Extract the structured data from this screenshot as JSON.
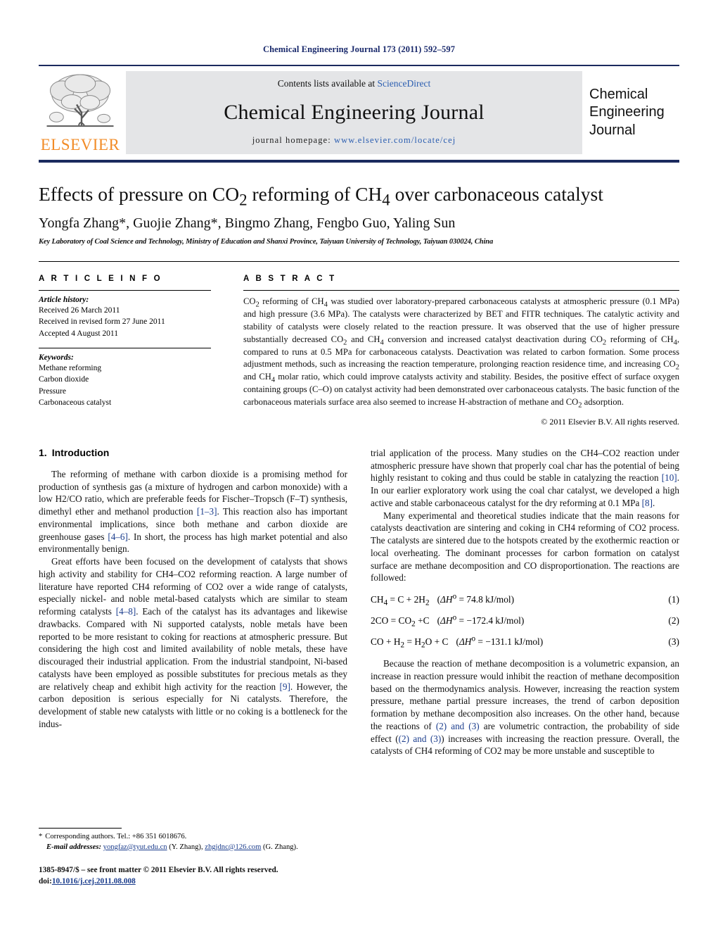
{
  "running_head": "Chemical Engineering Journal 173 (2011) 592–597",
  "masthead": {
    "publisher_logo_text": "ELSEVIER",
    "contents_prefix": "Contents lists available at",
    "contents_link": "ScienceDirect",
    "journal_title": "Chemical Engineering Journal",
    "homepage_prefix": "journal homepage:",
    "homepage_url": "www.elsevier.com/locate/cej",
    "cover_line_1": "Chemical",
    "cover_line_2": "Engineering",
    "cover_line_3": "Journal",
    "accent_color": "#F28C28",
    "link_color": "#2a5db0",
    "rule_color": "#1b2a5e"
  },
  "article": {
    "title_part_1": "Effects of pressure on CO",
    "title_sub_1": "2",
    "title_part_2": " reforming of CH",
    "title_sub_2": "4",
    "title_part_3": " over carbonaceous catalyst",
    "authors": "Yongfa Zhang*, Guojie Zhang*, Bingmo Zhang, Fengbo Guo, Yaling Sun",
    "affiliation": "Key Laboratory of Coal Science and Technology, Ministry of Education and Shanxi Province, Taiyuan University of Technology, Taiyuan 030024, China"
  },
  "article_info": {
    "heading": "A R T I C L E   I N F O",
    "history_label": "Article history:",
    "history": [
      "Received 26 March 2011",
      "Received in revised form 27 June 2011",
      "Accepted 4 August 2011"
    ],
    "keywords_label": "Keywords:",
    "keywords": [
      "Methane reforming",
      "Carbon dioxide",
      "Pressure",
      "Carbonaceous catalyst"
    ]
  },
  "abstract": {
    "heading": "A B S T R A C T",
    "text": "CO2 reforming of CH4 was studied over laboratory-prepared carbonaceous catalysts at atmospheric pressure (0.1 MPa) and high pressure (3.6 MPa). The catalysts were characterized by BET and FITR techniques. The catalytic activity and stability of catalysts were closely related to the reaction pressure. It was observed that the use of higher pressure substantially decreased CO2 and CH4 conversion and increased catalyst deactivation during CO2 reforming of CH4, compared to runs at 0.5 MPa for carbonaceous catalysts. Deactivation was related to carbon formation. Some process adjustment methods, such as increasing the reaction temperature, prolonging reaction residence time, and increasing CO2 and CH4 molar ratio, which could improve catalysts activity and stability. Besides, the positive effect of surface oxygen containing groups (C–O) on catalyst activity had been demonstrated over carbonaceous catalysts. The basic function of the carbonaceous materials surface area also seemed to increase H-abstraction of methane and CO2 adsorption.",
    "copyright": "© 2011 Elsevier B.V. All rights reserved."
  },
  "sections": {
    "intro_number": "1.",
    "intro_title": "Introduction"
  },
  "left_column": {
    "p1_a": "The reforming of methane with carbon dioxide is a promising method for production of synthesis gas (a mixture of hydrogen and carbon monoxide) with a low H2/CO ratio, which are preferable feeds for Fischer–Tropsch (F–T) synthesis, dimethyl ether and methanol production ",
    "p1_ref1": "[1–3]",
    "p1_b": ". This reaction also has important environmental implications, since both methane and carbon dioxide are greenhouse gases ",
    "p1_ref2": "[4–6]",
    "p1_c": ". In short, the process has high market potential and also environmentally benign.",
    "p2_a": "Great efforts have been focused on the development of catalysts that shows high activity and stability for CH4–CO2 reforming reaction. A large number of literature have reported CH4 reforming of CO2 over a wide range of catalysts, especially nickel- and noble metal-based catalysts which are similar to steam reforming catalysts ",
    "p2_ref1": "[4–8]",
    "p2_b": ". Each of the catalyst has its advantages and likewise drawbacks. Compared with Ni supported catalysts, noble metals have been reported to be more resistant to coking for reactions at atmospheric pressure. But considering the high cost and limited availability of noble metals, these have discouraged their industrial application. From the industrial standpoint, Ni-based catalysts have been employed as possible substitutes for precious metals as they are relatively cheap and exhibit high activity for the reaction ",
    "p2_ref2": "[9]",
    "p2_c": ". However, the carbon deposition is serious especially for Ni catalysts. Therefore, the development of stable new catalysts with little or no coking is a bottleneck for the indus-"
  },
  "right_column": {
    "p3_a": "trial application of the process. Many studies on the CH4–CO2 reaction under atmospheric pressure have shown that properly coal char has the potential of being highly resistant to coking and thus could be stable in catalyzing the reaction ",
    "p3_ref1": "[10]",
    "p3_b": ". In our earlier exploratory work using the coal char catalyst, we developed a high active and stable carbonaceous catalyst for the dry reforming at 0.1 MPa ",
    "p3_ref2": "[8]",
    "p3_c": ".",
    "p4": "Many experimental and theoretical studies indicate that the main reasons for catalysts deactivation are sintering and coking in CH4 reforming of CO2 process. The catalysts are sintered due to the hotspots created by the exothermic reaction or local overheating. The dominant processes for carbon formation on catalyst surface are methane decomposition and CO disproportionation. The reactions are followed:",
    "p5_a": "Because the reaction of methane decomposition is a volumetric expansion, an increase in reaction pressure would inhibit the reaction of methane decomposition based on the thermodynamics analysis. However, increasing the reaction system pressure, methane partial pressure increases, the trend of carbon deposition formation by methane decomposition also increases. On the other hand, because the reactions of ",
    "p5_ref1": "(2) and (3)",
    "p5_b": " are volumetric contraction, the probability of side effect (",
    "p5_ref2": "(2) and (3)",
    "p5_c": ") increases with increasing the reaction pressure. Overall, the catalysts of CH4 reforming of CO2 may be more unstable and susceptible to"
  },
  "equations": [
    {
      "label": "(1)",
      "lhs": "CH4 = C + 2H2",
      "enthalpy": "(ΔH° = 74.8 kJ/mol)"
    },
    {
      "label": "(2)",
      "lhs": "2CO = CO2 + C",
      "enthalpy": "(ΔH° = −172.4 kJ/mol)"
    },
    {
      "label": "(3)",
      "lhs": "CO + H2 = H2O + C",
      "enthalpy": "(ΔH° = −131.1 kJ/mol)"
    }
  ],
  "footnote": {
    "star": "*",
    "corresponding": "Corresponding authors. Tel.: +86 351 6018676.",
    "email_label": "E-mail addresses:",
    "email_1": "yongfaz@tyut.edu.cn",
    "email_1_owner": "(Y. Zhang),",
    "email_2": "zhgjdnc@126.com",
    "email_2_owner": "(G. Zhang)."
  },
  "colophon": {
    "issn_line": "1385-8947/$ – see front matter © 2011 Elsevier B.V. All rights reserved.",
    "doi_label": "doi:",
    "doi_value": "10.1016/j.cej.2011.08.008"
  }
}
